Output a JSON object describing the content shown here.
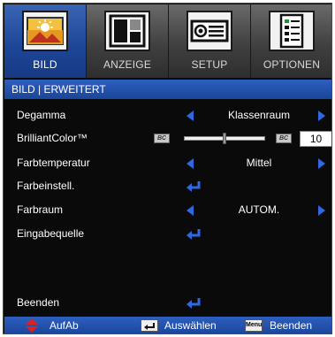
{
  "tabs": [
    {
      "label": "BILD",
      "icon": "picture-icon",
      "active": true
    },
    {
      "label": "ANZEIGE",
      "icon": "display-icon",
      "active": false
    },
    {
      "label": "SETUP",
      "icon": "projector-icon",
      "active": false
    },
    {
      "label": "OPTIONEN",
      "icon": "options-icon",
      "active": false
    }
  ],
  "title": "BILD | ERWEITERT",
  "rows": {
    "degamma": {
      "label": "Degamma",
      "value": "Klassenraum"
    },
    "brilliantcolor": {
      "label": "BrilliantColor™",
      "icon_text": "BC",
      "value": "10",
      "level_fraction": 0.5
    },
    "farbtemperatur": {
      "label": "Farbtemperatur",
      "value": "Mittel"
    },
    "farbeinstell": {
      "label": "Farbeinstell."
    },
    "farbraum": {
      "label": "Farbraum",
      "value": "AUTOM."
    },
    "eingabequelle": {
      "label": "Eingabequelle"
    },
    "beenden": {
      "label": "Beenden"
    }
  },
  "footer": {
    "updown_label": "AufAb",
    "select_label": "Auswählen",
    "menu_key_label": "Menu",
    "exit_label": "Beenden"
  },
  "colors": {
    "accent_blue": "#2f68e0",
    "bar_blue": "#1a4699",
    "updown_red": "#e02020"
  }
}
